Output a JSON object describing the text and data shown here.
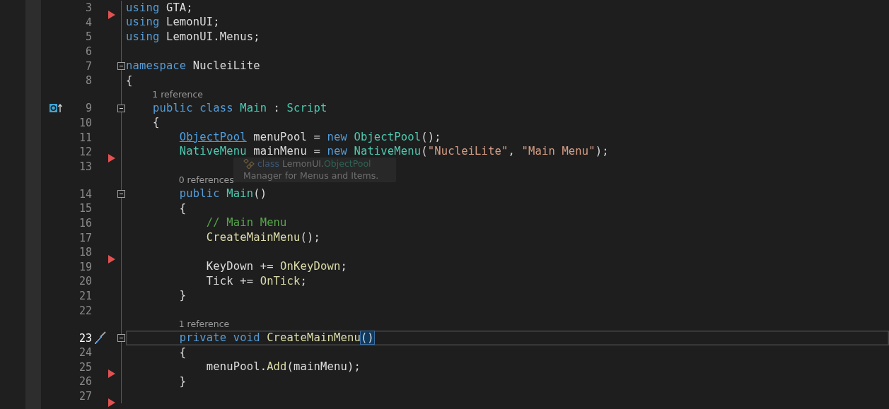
{
  "editor": {
    "rows": [
      {
        "kind": "code",
        "number": "3",
        "marker": true,
        "current": false,
        "tokens": [
          {
            "text": "using ",
            "kind": "kw"
          },
          {
            "text": "GTA;",
            "kind": "plain"
          }
        ]
      },
      {
        "kind": "code",
        "number": "4",
        "marker": false,
        "current": false,
        "tokens": [
          {
            "text": "using ",
            "kind": "kw"
          },
          {
            "text": "LemonUI;",
            "kind": "plain"
          }
        ]
      },
      {
        "kind": "code",
        "number": "5",
        "marker": false,
        "current": false,
        "tokens": [
          {
            "text": "using ",
            "kind": "kw"
          },
          {
            "text": "LemonUI.Menus;",
            "kind": "plain"
          }
        ]
      },
      {
        "kind": "code",
        "number": "6",
        "marker": false,
        "current": false,
        "tokens": []
      },
      {
        "kind": "code",
        "number": "7",
        "marker": false,
        "current": false,
        "expanded": true,
        "tokens": [
          {
            "text": "namespace ",
            "kind": "kw"
          },
          {
            "text": "NucleiLite",
            "kind": "plain"
          }
        ]
      },
      {
        "kind": "code",
        "number": "8",
        "marker": false,
        "current": false,
        "tokens": [
          {
            "text": "{",
            "kind": "plain"
          }
        ]
      },
      {
        "kind": "lens",
        "text": "1 reference"
      },
      {
        "kind": "code",
        "number": "9",
        "marker": false,
        "current": false,
        "expanded": true,
        "gutter": {
          "kind": "inherits"
        },
        "tokens": [
          {
            "text": "    public class ",
            "kind": "kw"
          },
          {
            "text": "Main",
            "kind": "type"
          },
          {
            "text": " : ",
            "kind": "plain"
          },
          {
            "text": "Script",
            "kind": "type"
          }
        ]
      },
      {
        "kind": "code",
        "number": "10",
        "marker": false,
        "current": false,
        "tokens": [
          {
            "text": "    {",
            "kind": "plain"
          }
        ]
      },
      {
        "kind": "code",
        "number": "11",
        "marker": false,
        "current": false,
        "tokens": [
          {
            "text": "        ObjectPool",
            "kind": "link"
          },
          {
            "text": " menuPool = ",
            "kind": "plain"
          },
          {
            "text": "new ",
            "kind": "kw"
          },
          {
            "text": "ObjectPool",
            "kind": "type"
          },
          {
            "text": "();",
            "kind": "plain"
          }
        ]
      },
      {
        "kind": "code",
        "number": "12",
        "marker": true,
        "current": false,
        "tokens": [
          {
            "text": "        NativeMenu",
            "kind": "type"
          },
          {
            "text": " mainMenu = ",
            "kind": "plain"
          },
          {
            "text": "new ",
            "kind": "kw"
          },
          {
            "text": "NativeMenu",
            "kind": "type"
          },
          {
            "text": "(",
            "kind": "plain"
          },
          {
            "text": "\"NucleiLite\"",
            "kind": "string"
          },
          {
            "text": ", ",
            "kind": "plain"
          },
          {
            "text": "\"Main Menu\"",
            "kind": "string"
          },
          {
            "text": ");",
            "kind": "plain"
          }
        ]
      },
      {
        "kind": "code",
        "number": "13",
        "marker": false,
        "current": false,
        "tokens": []
      },
      {
        "kind": "lens",
        "text": "0 references"
      },
      {
        "kind": "code",
        "number": "14",
        "marker": false,
        "current": false,
        "expanded": true,
        "tokens": [
          {
            "text": "        public ",
            "kind": "kw"
          },
          {
            "text": "Main",
            "kind": "type"
          },
          {
            "text": "()",
            "kind": "plain"
          }
        ]
      },
      {
        "kind": "code",
        "number": "15",
        "marker": false,
        "current": false,
        "tokens": [
          {
            "text": "        {",
            "kind": "plain"
          }
        ]
      },
      {
        "kind": "code",
        "number": "16",
        "marker": false,
        "current": false,
        "tokens": [
          {
            "text": "            // Main Menu",
            "kind": "comment"
          }
        ]
      },
      {
        "kind": "code",
        "number": "17",
        "marker": false,
        "current": false,
        "tokens": [
          {
            "text": "            CreateMainMenu",
            "kind": "method"
          },
          {
            "text": "();",
            "kind": "plain"
          }
        ]
      },
      {
        "kind": "code",
        "number": "18",
        "marker": true,
        "current": false,
        "tokens": []
      },
      {
        "kind": "code",
        "number": "19",
        "marker": false,
        "current": false,
        "tokens": [
          {
            "text": "            KeyDown += ",
            "kind": "plain"
          },
          {
            "text": "OnKeyDown",
            "kind": "method"
          },
          {
            "text": ";",
            "kind": "plain"
          }
        ]
      },
      {
        "kind": "code",
        "number": "20",
        "marker": false,
        "current": false,
        "tokens": [
          {
            "text": "            Tick += ",
            "kind": "plain"
          },
          {
            "text": "OnTick",
            "kind": "method"
          },
          {
            "text": ";",
            "kind": "plain"
          }
        ]
      },
      {
        "kind": "code",
        "number": "21",
        "marker": false,
        "current": false,
        "tokens": [
          {
            "text": "        }",
            "kind": "plain"
          }
        ]
      },
      {
        "kind": "code",
        "number": "22",
        "marker": false,
        "current": false,
        "tokens": []
      },
      {
        "kind": "lens",
        "text": "1 reference"
      },
      {
        "kind": "code",
        "number": "23",
        "marker": false,
        "current": true,
        "expanded": true,
        "gutter": {
          "kind": "quick-actions"
        },
        "tokens": [
          {
            "text": "        private void ",
            "kind": "kw"
          },
          {
            "text": "CreateMainMenu",
            "kind": "method"
          },
          {
            "text": "()",
            "kind": "brace-match"
          }
        ]
      },
      {
        "kind": "code",
        "number": "24",
        "marker": false,
        "current": false,
        "tokens": [
          {
            "text": "        {",
            "kind": "plain"
          }
        ]
      },
      {
        "kind": "code",
        "number": "25",
        "marker": true,
        "current": false,
        "tokens": [
          {
            "text": "            menuPool.",
            "kind": "plain"
          },
          {
            "text": "Add",
            "kind": "method"
          },
          {
            "text": "(mainMenu);",
            "kind": "plain"
          }
        ]
      },
      {
        "kind": "code",
        "number": "26",
        "marker": false,
        "current": false,
        "tokens": [
          {
            "text": "        }",
            "kind": "plain"
          }
        ]
      },
      {
        "kind": "code",
        "number": "27",
        "marker": true,
        "current": false,
        "tokens": []
      }
    ],
    "tooltip": {
      "signature": [
        {
          "text": "class ",
          "kind": "kw"
        },
        {
          "text": "LemonUI.",
          "kind": "plain"
        },
        {
          "text": "ObjectPool",
          "kind": "type"
        }
      ],
      "description": "Manager for Menus and Items."
    }
  }
}
